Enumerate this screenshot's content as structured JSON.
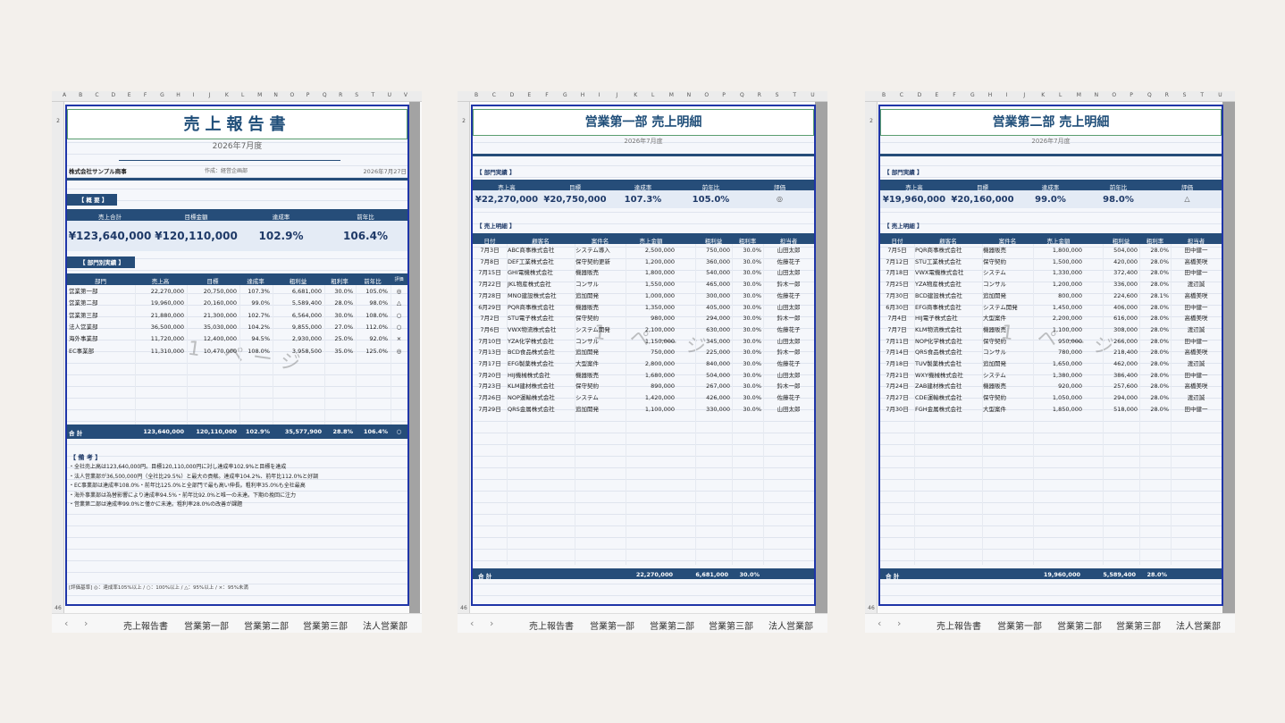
{
  "windows": [
    {
      "title": "売上報告書",
      "period": "2026年7月度",
      "company": "株式会社サンプル商事",
      "author": "作成：経営企画部",
      "date": "2026年7月27日",
      "summary_label": "【 概 要 】",
      "summary_headers": [
        "売上合計",
        "目標金額",
        "達成率",
        "前年比"
      ],
      "summary_values": [
        "¥123,640,000",
        "¥120,110,000",
        "102.9%",
        "106.4%"
      ],
      "dept_label": "【 部門別実績 】",
      "dept_headers": [
        "部門",
        "売上高",
        "目標",
        "達成率",
        "粗利益",
        "粗利率",
        "前年比",
        "評価"
      ],
      "dept_rows": [
        [
          "営業第一部",
          "22,270,000",
          "20,750,000",
          "107.3%",
          "6,681,000",
          "30.0%",
          "105.0%",
          "◎"
        ],
        [
          "営業第二部",
          "19,960,000",
          "20,160,000",
          "99.0%",
          "5,589,400",
          "28.0%",
          "98.0%",
          "△"
        ],
        [
          "営業第三部",
          "21,880,000",
          "21,300,000",
          "102.7%",
          "6,564,000",
          "30.0%",
          "108.0%",
          "○"
        ],
        [
          "法人営業部",
          "36,500,000",
          "35,030,000",
          "104.2%",
          "9,855,000",
          "27.0%",
          "112.0%",
          "○"
        ],
        [
          "海外事業部",
          "11,720,000",
          "12,400,000",
          "94.5%",
          "2,930,000",
          "25.0%",
          "92.0%",
          "×"
        ],
        [
          "EC事業部",
          "11,310,000",
          "10,470,000",
          "108.0%",
          "3,958,500",
          "35.0%",
          "125.0%",
          "◎"
        ]
      ],
      "total": [
        "合 計",
        "123,640,000",
        "120,110,000",
        "102.9%",
        "35,577,900",
        "28.8%",
        "106.4%",
        "○"
      ],
      "notes_label": "【 備 考 】",
      "notes": [
        "・全社売上高は123,640,000円。目標120,110,000円に対し達成率102.9%と目標を達成",
        "・法人営業部が36,500,000円（全社比29.5%）と最大の貢献。達成率104.2%、前年比112.0%と好調",
        "・EC事業部は達成率108.0%・前年比125.0%と全部門で最も高い伸長。粗利率35.0%も全社最高",
        "・海外事業部は為替影響により達成率94.5%・前年比92.0%と唯一の未達。下期の挽回に注力",
        "・営業第二部は達成率99.0%と僅かに未達。粗利率28.0%の改善が課題"
      ],
      "criteria": "[評価基準] ◎：達成率105%以上 / ○：100%以上 / △：95%以上 / ×：95%未満",
      "watermark": "1 ページ",
      "tabs": [
        "売上報告書",
        "営業第一部",
        "営業第二部",
        "営業第三部",
        "法人営業部"
      ],
      "active_tab": 0
    },
    {
      "title": "営業第一部 売上明細",
      "period": "2026年7月度",
      "kpi_label": "【 部門実績 】",
      "kpi_headers": [
        "売上高",
        "目標",
        "達成率",
        "前年比",
        "評価"
      ],
      "kpi_values": [
        "¥22,270,000",
        "¥20,750,000",
        "107.3%",
        "105.0%",
        "◎"
      ],
      "detail_label": "【 売上明細 】",
      "detail_headers": [
        "日付",
        "顧客名",
        "案件名",
        "売上金額",
        "粗利益",
        "粗利率",
        "担当者"
      ],
      "rows": [
        [
          "7月3日",
          "ABC商事株式会社",
          "システム導入",
          "2,500,000",
          "750,000",
          "30.0%",
          "山田太郎"
        ],
        [
          "7月8日",
          "DEF工業株式会社",
          "保守契約更新",
          "1,200,000",
          "360,000",
          "30.0%",
          "佐藤花子"
        ],
        [
          "7月15日",
          "GHI電機株式会社",
          "機器販売",
          "1,800,000",
          "540,000",
          "30.0%",
          "山田太郎"
        ],
        [
          "7月22日",
          "JKL物産株式会社",
          "コンサル",
          "1,550,000",
          "465,000",
          "30.0%",
          "鈴木一郎"
        ],
        [
          "7月28日",
          "MNO建設株式会社",
          "追加開発",
          "1,000,000",
          "300,000",
          "30.0%",
          "佐藤花子"
        ],
        [
          "6月29日",
          "PQR商事株式会社",
          "機器販売",
          "1,350,000",
          "405,000",
          "30.0%",
          "山田太郎"
        ],
        [
          "7月2日",
          "STU電子株式会社",
          "保守契約",
          "980,000",
          "294,000",
          "30.0%",
          "鈴木一郎"
        ],
        [
          "7月6日",
          "VWX物流株式会社",
          "システム開発",
          "2,100,000",
          "630,000",
          "30.0%",
          "佐藤花子"
        ],
        [
          "7月10日",
          "YZA化学株式会社",
          "コンサル",
          "1,150,000",
          "345,000",
          "30.0%",
          "山田太郎"
        ],
        [
          "7月13日",
          "BCD食品株式会社",
          "追加開発",
          "750,000",
          "225,000",
          "30.0%",
          "鈴木一郎"
        ],
        [
          "7月17日",
          "EFG製薬株式会社",
          "大型案件",
          "2,800,000",
          "840,000",
          "30.0%",
          "佐藤花子"
        ],
        [
          "7月20日",
          "HIJ機械株式会社",
          "機器販売",
          "1,680,000",
          "504,000",
          "30.0%",
          "山田太郎"
        ],
        [
          "7月23日",
          "KLM建材株式会社",
          "保守契約",
          "890,000",
          "267,000",
          "30.0%",
          "鈴木一郎"
        ],
        [
          "7月26日",
          "NOP運輸株式会社",
          "システム",
          "1,420,000",
          "426,000",
          "30.0%",
          "佐藤花子"
        ],
        [
          "7月29日",
          "QRS金属株式会社",
          "追加開発",
          "1,100,000",
          "330,000",
          "30.0%",
          "山田太郎"
        ]
      ],
      "total": [
        "合 計",
        "22,270,000",
        "6,681,000",
        "30.0%"
      ],
      "watermark": "1 ページ",
      "tabs": [
        "売上報告書",
        "営業第一部",
        "営業第二部",
        "営業第三部",
        "法人営業部"
      ],
      "active_tab": 1
    },
    {
      "title": "営業第二部 売上明細",
      "period": "2026年7月度",
      "kpi_label": "【 部門実績 】",
      "kpi_headers": [
        "売上高",
        "目標",
        "達成率",
        "前年比",
        "評価"
      ],
      "kpi_values": [
        "¥19,960,000",
        "¥20,160,000",
        "99.0%",
        "98.0%",
        "△"
      ],
      "detail_label": "【 売上明細 】",
      "detail_headers": [
        "日付",
        "顧客名",
        "案件名",
        "売上金額",
        "粗利益",
        "粗利率",
        "担当者"
      ],
      "rows": [
        [
          "7月5日",
          "PQR商事株式会社",
          "機器販売",
          "1,800,000",
          "504,000",
          "28.0%",
          "田中健一"
        ],
        [
          "7月12日",
          "STU工業株式会社",
          "保守契約",
          "1,500,000",
          "420,000",
          "28.0%",
          "高橋美咲"
        ],
        [
          "7月18日",
          "VWX電機株式会社",
          "システム",
          "1,330,000",
          "372,400",
          "28.0%",
          "田中健一"
        ],
        [
          "7月25日",
          "YZA物産株式会社",
          "コンサル",
          "1,200,000",
          "336,000",
          "28.0%",
          "渡辺誠"
        ],
        [
          "7月30日",
          "BCD建設株式会社",
          "追加開発",
          "800,000",
          "224,600",
          "28.1%",
          "高橋美咲"
        ],
        [
          "6月30日",
          "EFG商事株式会社",
          "システム開発",
          "1,450,000",
          "406,000",
          "28.0%",
          "田中健一"
        ],
        [
          "7月4日",
          "HIJ電子株式会社",
          "大型案件",
          "2,200,000",
          "616,000",
          "28.0%",
          "高橋美咲"
        ],
        [
          "7月7日",
          "KLM物流株式会社",
          "機器販売",
          "1,100,000",
          "308,000",
          "28.0%",
          "渡辺誠"
        ],
        [
          "7月11日",
          "NOP化学株式会社",
          "保守契約",
          "950,000",
          "266,000",
          "28.0%",
          "田中健一"
        ],
        [
          "7月14日",
          "QRS食品株式会社",
          "コンサル",
          "780,000",
          "218,400",
          "28.0%",
          "高橋美咲"
        ],
        [
          "7月18日",
          "TUV製薬株式会社",
          "追加開発",
          "1,650,000",
          "462,000",
          "28.0%",
          "渡辺誠"
        ],
        [
          "7月21日",
          "WXY機械株式会社",
          "システム",
          "1,380,000",
          "386,400",
          "28.0%",
          "田中健一"
        ],
        [
          "7月24日",
          "ZAB建材株式会社",
          "機器販売",
          "920,000",
          "257,600",
          "28.0%",
          "高橋美咲"
        ],
        [
          "7月27日",
          "CDE運輸株式会社",
          "保守契約",
          "1,050,000",
          "294,000",
          "28.0%",
          "渡辺誠"
        ],
        [
          "7月30日",
          "FGH金属株式会社",
          "大型案件",
          "1,850,000",
          "518,000",
          "28.0%",
          "田中健一"
        ]
      ],
      "total": [
        "合 計",
        "19,960,000",
        "5,589,400",
        "28.0%"
      ],
      "watermark": "1 ページ",
      "tabs": [
        "売上報告書",
        "営業第一部",
        "営業第二部",
        "営業第三部",
        "法人営業部"
      ],
      "active_tab": 2
    }
  ],
  "columns": {
    "w1": [
      "A",
      "B",
      "C",
      "D",
      "E",
      "F",
      "G",
      "H",
      "I",
      "J",
      "K",
      "L",
      "M",
      "N",
      "O",
      "P",
      "Q",
      "R",
      "S",
      "T",
      "U",
      "V"
    ],
    "w2": [
      "B",
      "C",
      "D",
      "E",
      "F",
      "G",
      "H",
      "I",
      "J",
      "K",
      "L",
      "M",
      "N",
      "O",
      "P",
      "Q",
      "R",
      "S",
      "T",
      "U"
    ],
    "w3": [
      "B",
      "C",
      "D",
      "E",
      "F",
      "G",
      "H",
      "I",
      "J",
      "K",
      "L",
      "M",
      "N",
      "O",
      "P",
      "Q",
      "R",
      "S",
      "T",
      "U"
    ]
  },
  "row_numbers_first": "2",
  "row_numbers_last": "46",
  "colors": {
    "header": "#264d79",
    "border": "#1f35a8",
    "title": "#1f4e79"
  }
}
